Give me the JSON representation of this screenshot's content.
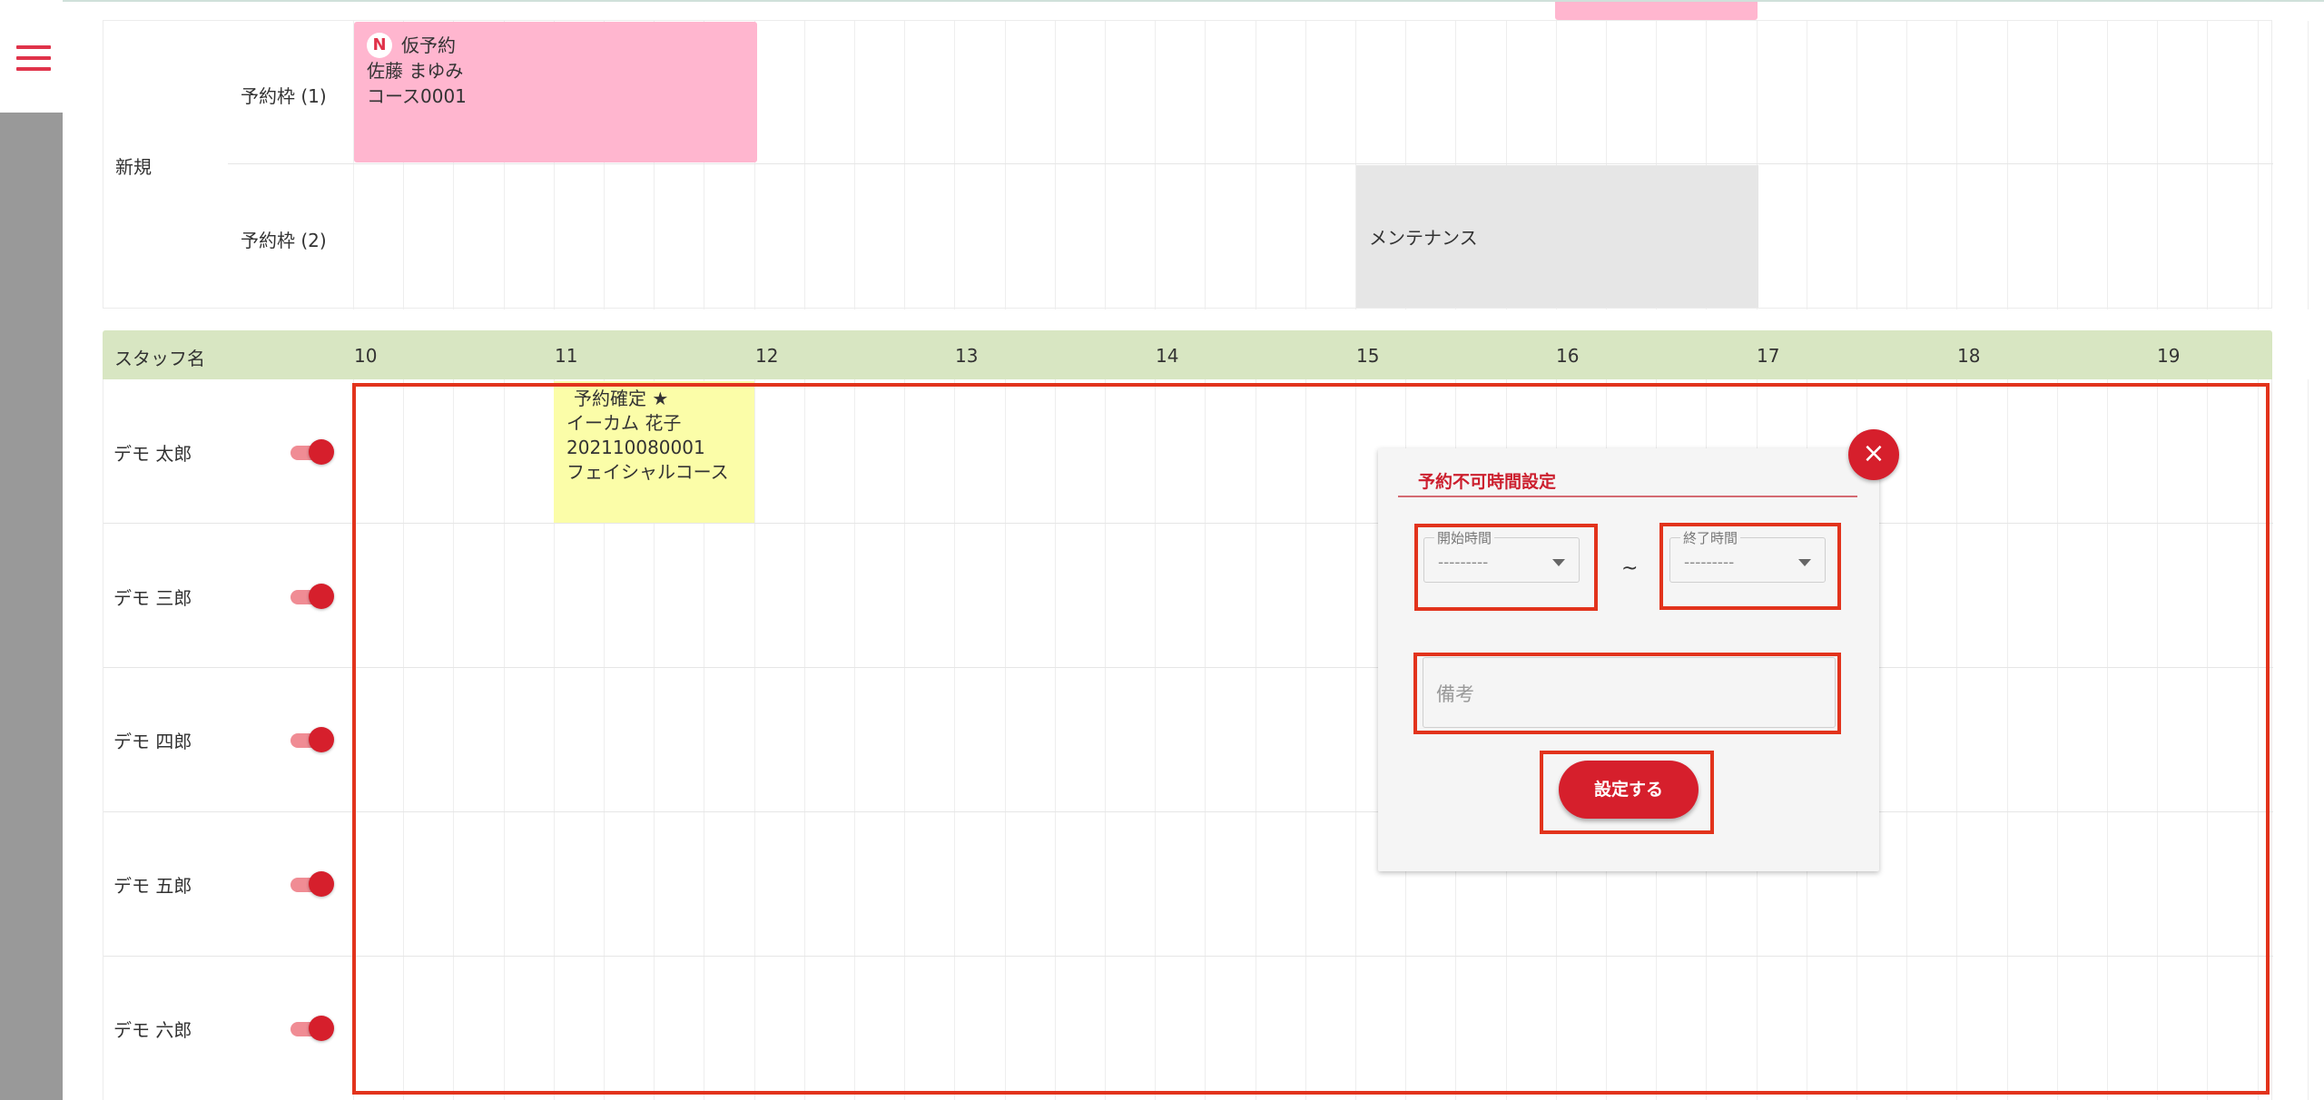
{
  "top_section": {
    "category_label": "新規",
    "slots": [
      {
        "label": "予約枠 (1)"
      },
      {
        "label": "予約枠 (2)"
      }
    ],
    "tentative_booking": {
      "badge": "N",
      "status": "仮予約",
      "customer": "佐藤 まゆみ",
      "course": "コース0001"
    },
    "maintenance_block": {
      "label": "メンテナンス"
    }
  },
  "schedule": {
    "staff_header": "スタッフ名",
    "hours": [
      "10",
      "11",
      "12",
      "13",
      "14",
      "15",
      "16",
      "17",
      "18",
      "19"
    ],
    "staff": [
      {
        "name": "デモ 太郎",
        "enabled": true
      },
      {
        "name": "デモ 三郎",
        "enabled": true
      },
      {
        "name": "デモ 四郎",
        "enabled": true
      },
      {
        "name": "デモ 五郎",
        "enabled": true
      },
      {
        "name": "デモ 六郎",
        "enabled": true
      }
    ],
    "confirmed_booking": {
      "status": "予約確定 ★",
      "customer": "イーカム 花子",
      "booking_no": "202110080001",
      "course": "フェイシャルコース"
    }
  },
  "modal": {
    "title": "予約不可時間設定",
    "close_icon": "×",
    "start_time": {
      "label": "開始時間",
      "value": "---------"
    },
    "separator": "~",
    "end_time": {
      "label": "終了時間",
      "value": "---------"
    },
    "memo_placeholder": "備考",
    "submit_label": "設定する"
  },
  "colors": {
    "accent": "#d61f2c",
    "highlight": "#e2331c",
    "header_bg": "#d8e6c2",
    "tentative_bg": "#ffb6cf",
    "confirmed_bg": "#fbfda8",
    "maintenance_bg": "#e6e6e6"
  }
}
